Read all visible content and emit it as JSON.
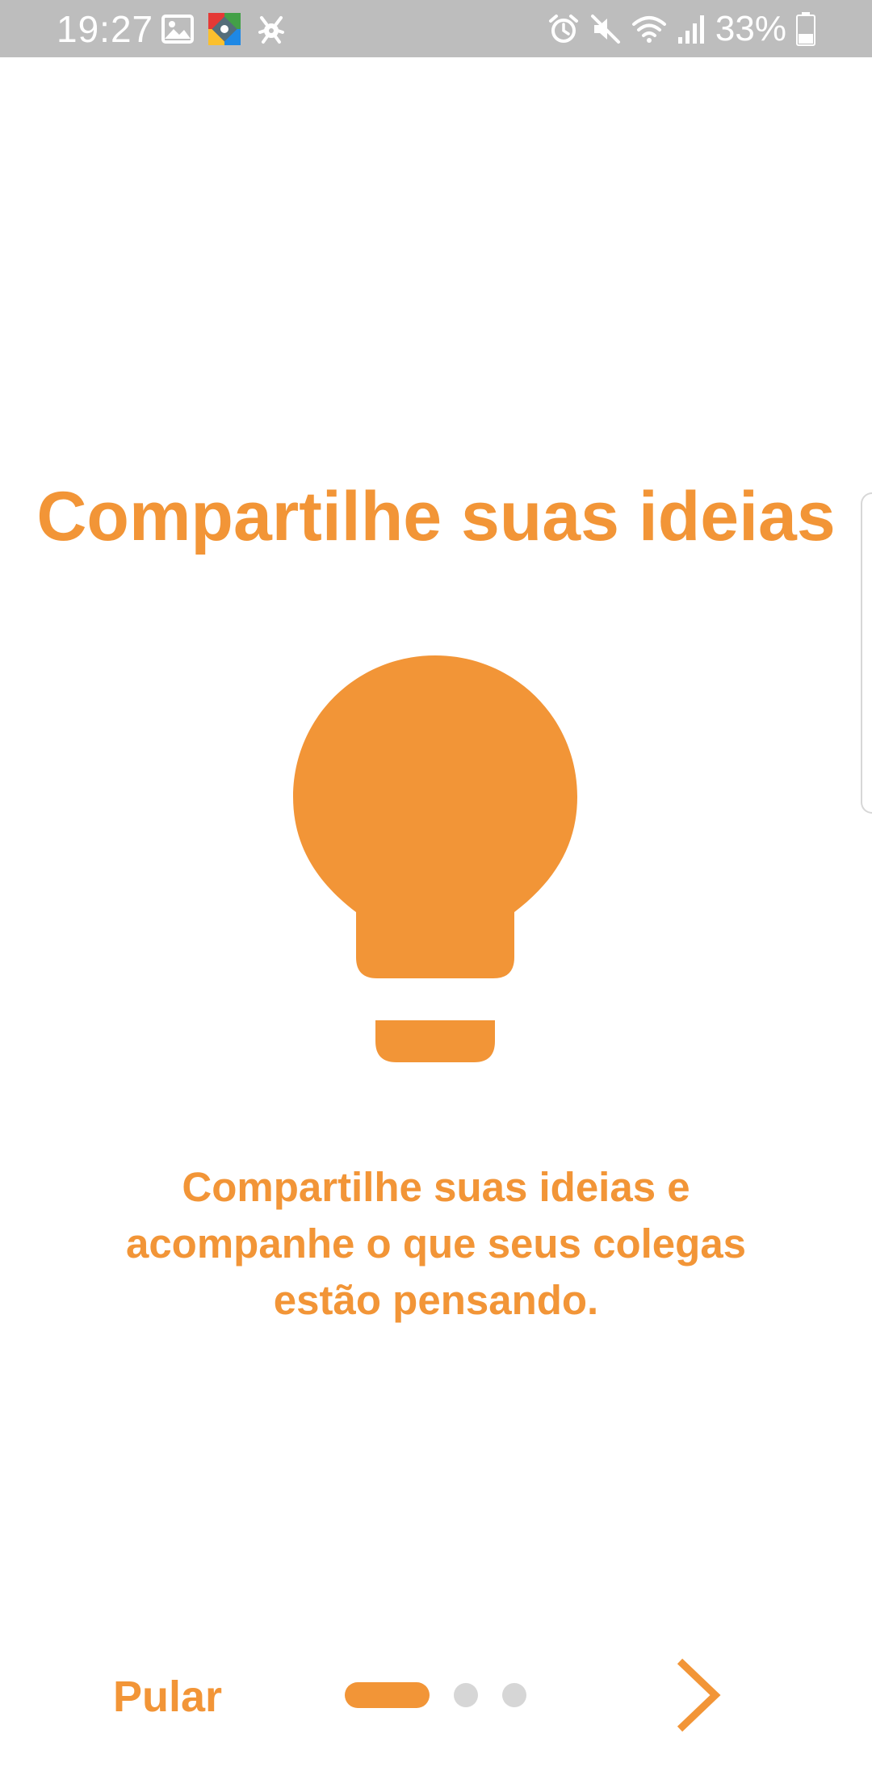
{
  "status_bar": {
    "time": "19:27",
    "battery_percent": "33%",
    "icons_left": [
      "gallery-icon",
      "app-icon",
      "crab-icon"
    ],
    "icons_right": [
      "alarm-icon",
      "mute-icon",
      "wifi-icon",
      "signal-icon",
      "battery-icon"
    ]
  },
  "onboarding": {
    "title": "Compartilhe suas ideias",
    "icon": "lightbulb-icon",
    "description_lines": [
      "Compartilhe suas ideias e",
      "acompanhe o que seus colegas",
      "estão pensando."
    ]
  },
  "navigation": {
    "skip_label": "Pular",
    "current_page": 1,
    "total_pages": 3,
    "next_icon": "chevron-right-icon"
  },
  "colors": {
    "accent": "#f29537",
    "status_bar": "#bdbdbd",
    "inactive_dot": "#d6d6d6",
    "background": "#ffffff"
  }
}
